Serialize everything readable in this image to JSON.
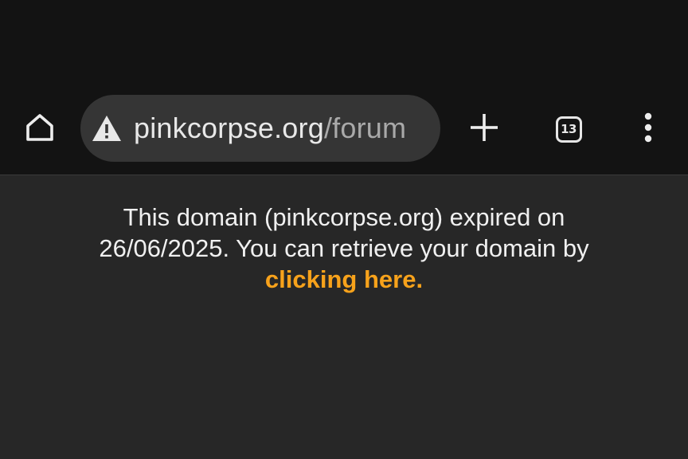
{
  "browser": {
    "url_domain": "pinkcorpse.org",
    "url_path": "/forum",
    "tab_count": "13",
    "icons": {
      "home": "home-icon",
      "security": "warning-icon",
      "new_tab": "plus-icon",
      "tabs": "tab-switcher-icon",
      "menu": "more-vert-icon"
    },
    "colors": {
      "toolbar_bg": "#131313",
      "omnibox_bg": "#353535",
      "page_bg": "#272727"
    }
  },
  "page": {
    "message_line1": "This domain (pinkcorpse.org) expired on",
    "message_line2": "26/06/2025. You can retrieve your domain by",
    "link_text": "clicking here.",
    "link_color": "#f7a21b"
  }
}
